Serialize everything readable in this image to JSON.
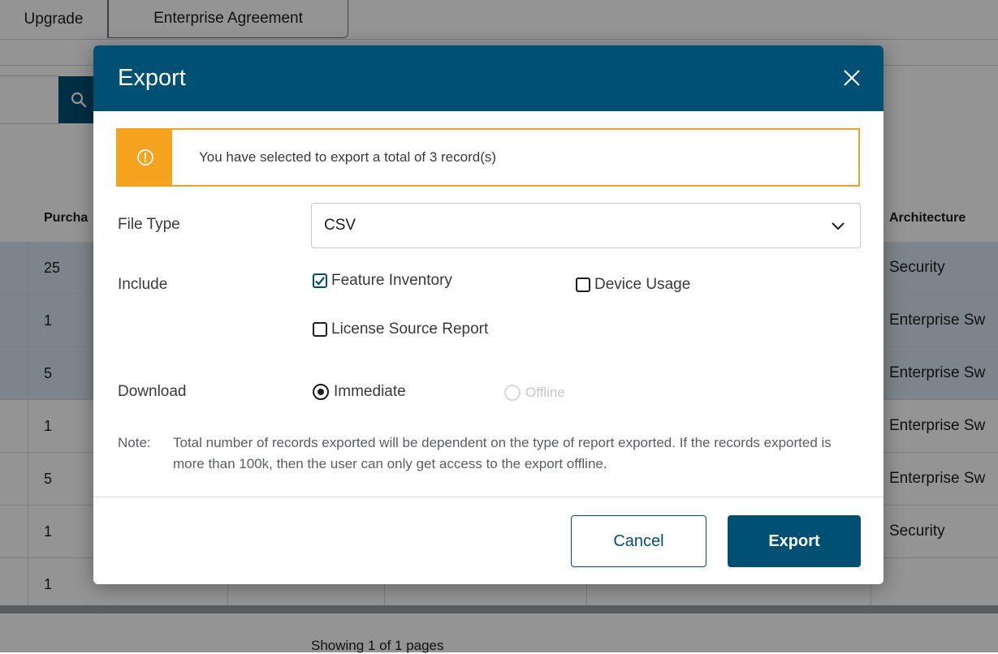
{
  "background": {
    "tabs": [
      "Upgrade",
      "Enterprise Agreement"
    ],
    "columns": {
      "purchased": "Purcha",
      "architecture": "Architecture"
    },
    "rows": [
      {
        "purchased": "25",
        "architecture": "Security",
        "selected": true
      },
      {
        "purchased": "1",
        "architecture": "Enterprise Sw",
        "selected": true
      },
      {
        "purchased": "5",
        "architecture": "Enterprise Sw",
        "selected": true
      },
      {
        "purchased": "1",
        "architecture": "Enterprise Sw",
        "selected": false
      },
      {
        "purchased": "5",
        "architecture": "Enterprise Sw",
        "selected": false
      },
      {
        "purchased": "1",
        "architecture": "Security",
        "selected": false
      },
      {
        "purchased": "1",
        "architecture": "",
        "selected": false
      }
    ],
    "pagination": "Showing 1 of 1 pages"
  },
  "modal": {
    "title": "Export",
    "close_icon": "close-icon",
    "alert": {
      "icon": "warning-icon",
      "message": "You have selected to export a total of 3 record(s)"
    },
    "file_type": {
      "label": "File Type",
      "value": "CSV"
    },
    "include": {
      "label": "Include",
      "options": [
        {
          "label": "Feature Inventory",
          "checked": true
        },
        {
          "label": "Device Usage",
          "checked": false
        },
        {
          "label": "License Source Report",
          "checked": false
        }
      ]
    },
    "download": {
      "label": "Download",
      "options": [
        {
          "label": "Immediate",
          "selected": true,
          "disabled": false
        },
        {
          "label": "Offline",
          "selected": false,
          "disabled": true
        }
      ]
    },
    "note": {
      "label": "Note:",
      "text": "Total number of records exported will be dependent on the type of report exported. If the records exported is more than 100k, then the user can only get access to the export offline."
    },
    "buttons": {
      "cancel": "Cancel",
      "export": "Export"
    }
  },
  "colors": {
    "primary": "#005073",
    "warning": "#f5a31f",
    "selected_row": "#d6e6f0"
  }
}
